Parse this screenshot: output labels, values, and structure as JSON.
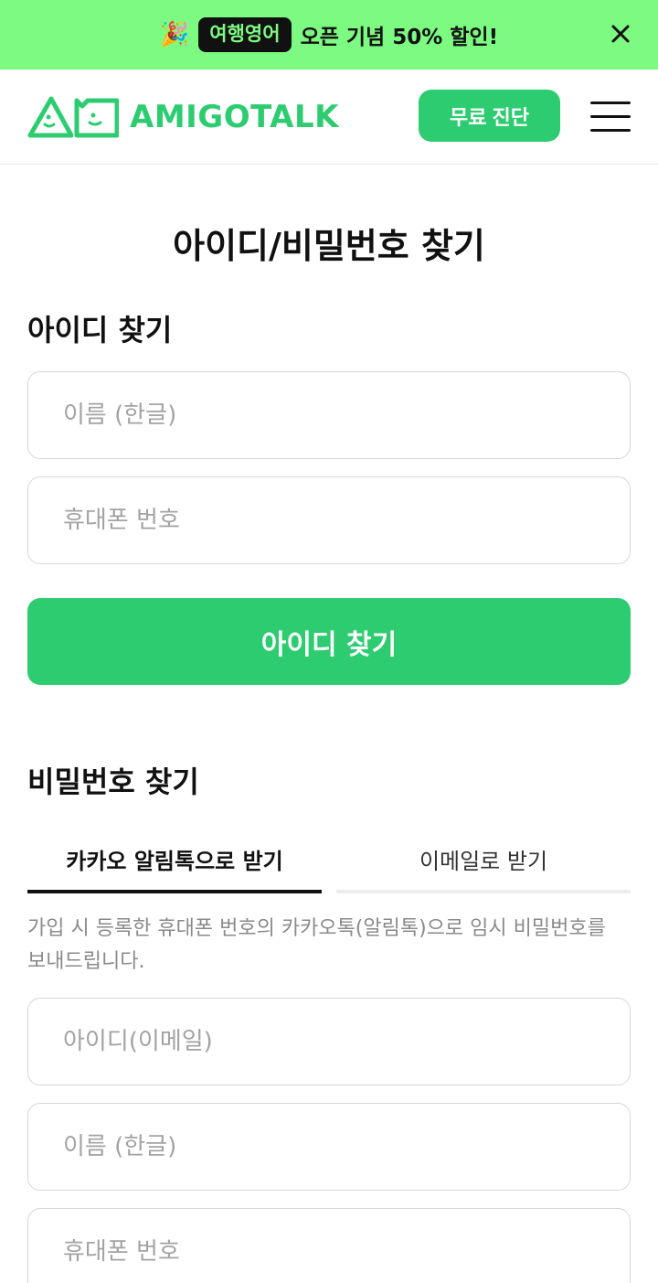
{
  "promo": {
    "emoji": "🎉",
    "badge": "여행영어",
    "text": "오픈 기념 50% 할인!",
    "close": "close"
  },
  "header": {
    "logo_text": "AMIGOTALK",
    "cta_label": "무료 진단",
    "menu": "menu"
  },
  "page_title": "아이디/비밀번호 찾기",
  "find_id": {
    "title": "아이디 찾기",
    "name_placeholder": "이름 (한글)",
    "phone_placeholder": "휴대폰 번호",
    "button_label": "아이디 찾기"
  },
  "find_pw": {
    "title": "비밀번호 찾기",
    "tabs": [
      {
        "label": "카카오 알림톡으로 받기",
        "active": true
      },
      {
        "label": "이메일로 받기",
        "active": false
      }
    ],
    "note": "가입 시 등록한 휴대폰 번호의 카카오톡(알림톡)으로 임시 비밀번호를 보내드립니다.",
    "id_placeholder": "아이디(이메일)",
    "name_placeholder": "이름 (한글)",
    "phone_placeholder": "휴대폰 번호"
  },
  "colors": {
    "promo_bg": "#7dfa82",
    "brand_green": "#2ecc71",
    "text": "#111111",
    "placeholder": "#a3a3a3"
  }
}
